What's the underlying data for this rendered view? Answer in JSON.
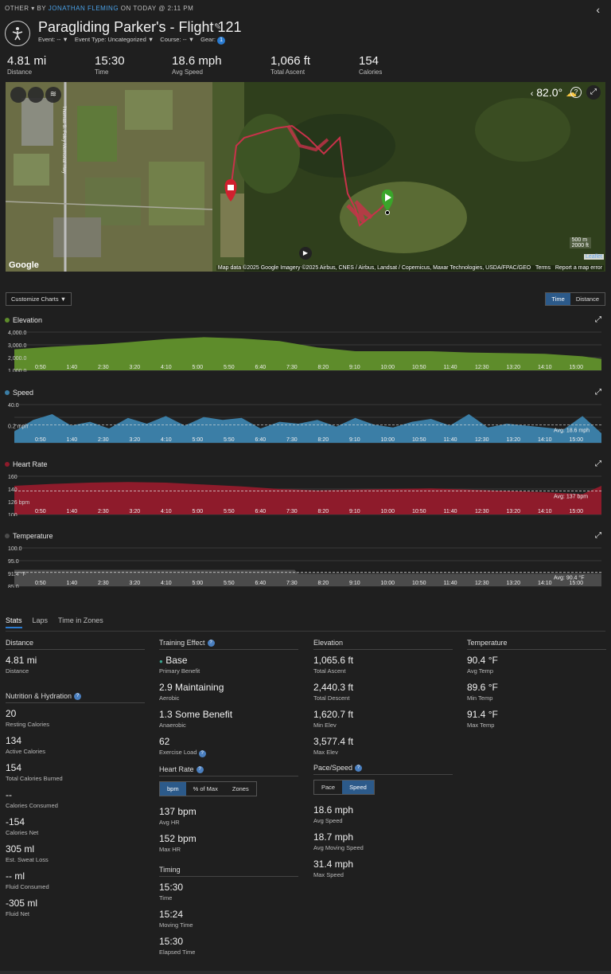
{
  "header": {
    "category": "OTHER",
    "by_prefix": "BY",
    "author": "JONATHAN FLEMING",
    "date": "ON TODAY @ 2:11 PM",
    "back_icon": "chevron-left-icon",
    "title": "Paragliding Parker's - Flight 121",
    "event_label": "Event: --",
    "event_type": "Event Type: Uncategorized",
    "course": "Course: --",
    "gear_label": "Gear:",
    "gear_count": "1"
  },
  "summary": [
    {
      "value": "4.81 mi",
      "label": "Distance"
    },
    {
      "value": "15:30",
      "label": "Time"
    },
    {
      "value": "18.6 mph",
      "label": "Avg Speed"
    },
    {
      "value": "1,066 ft",
      "label": "Total Ascent"
    },
    {
      "value": "154",
      "label": "Calories"
    }
  ],
  "map": {
    "temperature": "82.0°",
    "help": "?",
    "scale_m": "500 m",
    "scale_ft": "2000 ft",
    "leaflet": "Leaflet",
    "google": "Google",
    "attribution": "Map data ©2025 Google Imagery ©2025 Airbus, CNES / Airbus, Landsat / Copernicus, Maxar Technologies, USDA/FPAC/GEO",
    "terms": "Terms",
    "report": "Report a map error",
    "road_label": "Thomas S. Foley Memorial Hwy"
  },
  "chart_controls": {
    "customize": "Customize Charts",
    "time": "Time",
    "distance": "Distance"
  },
  "chart_data": [
    {
      "type": "area",
      "title": "Elevation",
      "color": "#5e8c2b",
      "x_ticks": [
        "0:50",
        "1:40",
        "2:30",
        "3:20",
        "4:10",
        "5:00",
        "5:50",
        "6:40",
        "7:30",
        "8:20",
        "9:10",
        "10:00",
        "10:50",
        "11:40",
        "12:30",
        "13:20",
        "14:10",
        "15:00"
      ],
      "y_ticks": [
        "4,000.0",
        "3,000.0",
        "2,000.0",
        "1,000.0"
      ],
      "ylim": [
        1000,
        4000
      ],
      "x": [
        0,
        1,
        2,
        3,
        4,
        5,
        6,
        7,
        8,
        9,
        10,
        11,
        12,
        13,
        14,
        15,
        15.5
      ],
      "values": [
        2650,
        2850,
        3000,
        3200,
        3450,
        3600,
        3500,
        3300,
        2800,
        2500,
        2500,
        2500,
        2400,
        2350,
        2300,
        2100,
        1900
      ]
    },
    {
      "type": "area",
      "title": "Speed",
      "color": "#3b7ea6",
      "x_ticks": [
        "0:50",
        "1:40",
        "2:30",
        "3:20",
        "4:10",
        "5:00",
        "5:50",
        "6:40",
        "7:30",
        "8:20",
        "9:10",
        "10:00",
        "10:50",
        "11:40",
        "12:30",
        "13:20",
        "14:10",
        "15:00"
      ],
      "y_ticks": [
        "40.0",
        "0.2 mph"
      ],
      "avg_label": "Avg: 18.6 mph",
      "avg": 18.6,
      "ylim": [
        0,
        40
      ],
      "x": [
        0,
        0.5,
        1,
        1.5,
        2,
        2.5,
        3,
        3.5,
        4,
        4.5,
        5,
        5.5,
        6,
        6.5,
        7,
        7.5,
        8,
        8.5,
        9,
        9.5,
        10,
        10.5,
        11,
        11.5,
        12,
        12.5,
        13,
        13.5,
        14,
        14.5,
        15,
        15.5
      ],
      "values": [
        12,
        24,
        30,
        18,
        22,
        15,
        26,
        20,
        28,
        18,
        27,
        24,
        26,
        15,
        22,
        20,
        24,
        17,
        26,
        19,
        16,
        22,
        25,
        18,
        30,
        16,
        20,
        18,
        16,
        14,
        28,
        10
      ]
    },
    {
      "type": "area",
      "title": "Heart Rate",
      "color": "#8e1b2b",
      "x_ticks": [
        "0:50",
        "1:40",
        "2:30",
        "3:20",
        "4:10",
        "5:00",
        "5:50",
        "6:40",
        "7:30",
        "8:20",
        "9:10",
        "10:00",
        "10:50",
        "11:40",
        "12:30",
        "13:20",
        "14:10",
        "15:00"
      ],
      "y_ticks": [
        "160",
        "140",
        "126 bpm",
        "100"
      ],
      "avg_label": "Avg: 137 bpm",
      "avg": 137,
      "ylim": [
        100,
        160
      ],
      "x": [
        0,
        1,
        2,
        3,
        4,
        5,
        6,
        7,
        8,
        9,
        10,
        11,
        12,
        13,
        14,
        15,
        15.5
      ],
      "values": [
        145,
        148,
        150,
        151,
        150,
        147,
        144,
        140,
        138,
        139,
        140,
        141,
        139,
        137,
        135,
        132,
        145
      ]
    },
    {
      "type": "area",
      "title": "Temperature",
      "color": "#4b4b4b",
      "x_ticks": [
        "0:50",
        "1:40",
        "2:30",
        "3:20",
        "4:10",
        "5:00",
        "5:50",
        "6:40",
        "7:30",
        "8:20",
        "9:10",
        "10:00",
        "10:50",
        "11:40",
        "12:30",
        "13:20",
        "14:10",
        "15:00"
      ],
      "y_ticks": [
        "100.0",
        "95.0",
        "91.4 °F",
        "85.0"
      ],
      "avg_label": "Avg: 90.4 °F",
      "avg": 90.4,
      "ylim": [
        85,
        100
      ],
      "x": [
        0,
        7.4,
        7.5,
        15.5
      ],
      "values": [
        91.4,
        91.4,
        89.8,
        89.8
      ]
    }
  ],
  "tabs": [
    "Stats",
    "Laps",
    "Time in Zones"
  ],
  "stats": {
    "distance": {
      "title": "Distance",
      "items": [
        {
          "v": "4.81 mi",
          "l": "Distance"
        }
      ]
    },
    "nutrition": {
      "title": "Nutrition & Hydration",
      "items": [
        {
          "v": "20",
          "l": "Resting Calories"
        },
        {
          "v": "134",
          "l": "Active Calories"
        },
        {
          "v": "154",
          "l": "Total Calories Burned"
        },
        {
          "v": "--",
          "l": "Calories Consumed"
        },
        {
          "v": "-154",
          "l": "Calories Net"
        },
        {
          "v": "305 ml",
          "l": "Est. Sweat Loss"
        },
        {
          "v": "-- ml",
          "l": "Fluid Consumed"
        },
        {
          "v": "-305 ml",
          "l": "Fluid Net"
        }
      ]
    },
    "training": {
      "title": "Training Effect",
      "items": [
        {
          "v": "Base",
          "l": "Primary Benefit"
        },
        {
          "v": "2.9 Maintaining",
          "l": "Aerobic"
        },
        {
          "v": "1.3 Some Benefit",
          "l": "Anaerobic"
        },
        {
          "v": "62",
          "l": "Exercise Load"
        }
      ]
    },
    "heart_rate": {
      "title": "Heart Rate",
      "tabs": [
        "bpm",
        "% of Max",
        "Zones"
      ],
      "items": [
        {
          "v": "137 bpm",
          "l": "Avg HR"
        },
        {
          "v": "152 bpm",
          "l": "Max HR"
        }
      ]
    },
    "timing": {
      "title": "Timing",
      "items": [
        {
          "v": "15:30",
          "l": "Time"
        },
        {
          "v": "15:24",
          "l": "Moving Time"
        },
        {
          "v": "15:30",
          "l": "Elapsed Time"
        }
      ]
    },
    "elevation": {
      "title": "Elevation",
      "items": [
        {
          "v": "1,065.6 ft",
          "l": "Total Ascent"
        },
        {
          "v": "2,440.3 ft",
          "l": "Total Descent"
        },
        {
          "v": "1,620.7 ft",
          "l": "Min Elev"
        },
        {
          "v": "3,577.4 ft",
          "l": "Max Elev"
        }
      ]
    },
    "pace": {
      "title": "Pace/Speed",
      "tabs": [
        "Pace",
        "Speed"
      ],
      "items": [
        {
          "v": "18.6 mph",
          "l": "Avg Speed"
        },
        {
          "v": "18.7 mph",
          "l": "Avg Moving Speed"
        },
        {
          "v": "31.4 mph",
          "l": "Max Speed"
        }
      ]
    },
    "temperature": {
      "title": "Temperature",
      "items": [
        {
          "v": "90.4 °F",
          "l": "Avg Temp"
        },
        {
          "v": "89.6 °F",
          "l": "Min Temp"
        },
        {
          "v": "91.4 °F",
          "l": "Max Temp"
        }
      ]
    }
  }
}
